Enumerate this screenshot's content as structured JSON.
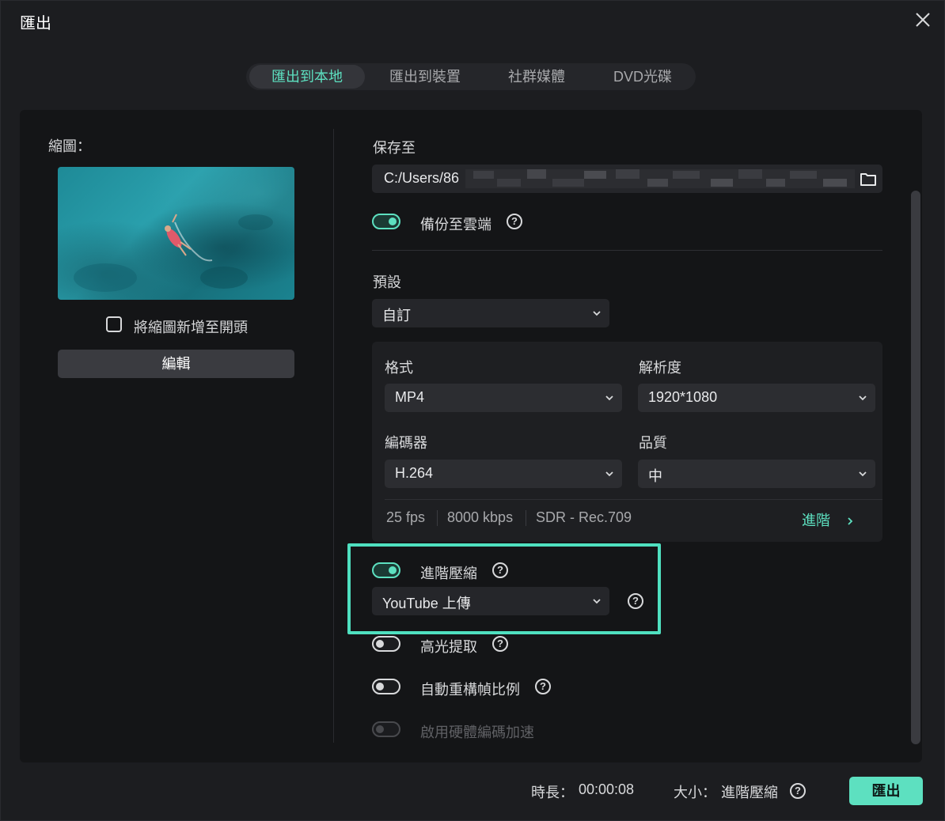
{
  "window": {
    "title": "匯出"
  },
  "tabs": [
    {
      "label": "匯出到本地",
      "active": true
    },
    {
      "label": "匯出到裝置",
      "active": false
    },
    {
      "label": "社群媒體",
      "active": false
    },
    {
      "label": "DVD光碟",
      "active": false
    }
  ],
  "left": {
    "thumbnail_label": "縮圖：",
    "add_to_start_label": "將縮圖新增至開頭",
    "add_to_start_checked": false,
    "edit_label": "編輯"
  },
  "right": {
    "save_to_label": "保存至",
    "save_path": "C:/Users/86",
    "cloud_backup_label": "備份至雲端",
    "cloud_backup_on": true,
    "preset_label": "預設",
    "preset_value": "自訂",
    "format_label": "格式",
    "format_value": "MP4",
    "resolution_label": "解析度",
    "resolution_value": "1920*1080",
    "encoder_label": "編碼器",
    "encoder_value": "H.264",
    "quality_label": "品質",
    "quality_value": "中",
    "fps": "25 fps",
    "bitrate": "8000 kbps",
    "color": "SDR - Rec.709",
    "advanced_label": "進階",
    "adv_compress_label": "進階壓縮",
    "adv_compress_on": true,
    "compress_preset_value": "YouTube 上傳",
    "highlight_label": "高光提取",
    "highlight_on": false,
    "auto_reframe_label": "自動重構幀比例",
    "auto_reframe_on": false,
    "hw_accel_label": "啟用硬體編碼加速",
    "hw_accel_on": false
  },
  "footer": {
    "duration_label": "時長：",
    "duration_value": "00:00:08",
    "size_label": "大小：",
    "size_value": "進階壓縮",
    "export_label": "匯出"
  },
  "colors": {
    "accent": "#5de0c0",
    "highlight_border": "#4fe0c0",
    "background": "#1c1d20",
    "panel": "#141517"
  },
  "icons": [
    "close-icon",
    "folder-icon",
    "help-icon",
    "chevron-down-icon",
    "chevron-right-icon"
  ]
}
